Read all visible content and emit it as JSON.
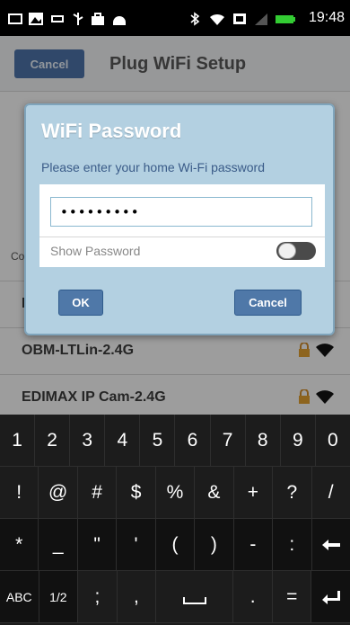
{
  "status_bar": {
    "time": "19:48",
    "icons": [
      "gallery-icon",
      "photo-icon",
      "usb-icon",
      "usb-debug-icon",
      "bag-icon",
      "android-icon",
      "bluetooth-icon",
      "wifi-icon",
      "nfc-icon",
      "signal-icon",
      "battery-icon"
    ]
  },
  "app": {
    "cancel_label": "Cancel",
    "title": "Plug WiFi Setup",
    "list_label_partial": "Co",
    "rows": [
      {
        "ssid": "E"
      },
      {
        "ssid": "OBM-LTLin-2.4G"
      },
      {
        "ssid": "EDIMAX IP Cam-2.4G"
      }
    ]
  },
  "dialog": {
    "title": "WiFi Password",
    "subtitle": "Please enter your home Wi-Fi password",
    "password_value": "•••••••••",
    "show_password_label": "Show Password",
    "show_password_on": false,
    "ok_label": "OK",
    "cancel_label": "Cancel"
  },
  "keyboard": {
    "row1": [
      "1",
      "2",
      "3",
      "4",
      "5",
      "6",
      "7",
      "8",
      "9",
      "0"
    ],
    "row2": [
      "!",
      "@",
      "#",
      "$",
      "%",
      "&",
      "+",
      "?",
      "/"
    ],
    "row3": [
      "*",
      "_",
      "\"",
      "'",
      "(",
      ")",
      "-",
      ":"
    ],
    "row4": [
      "ABC",
      "1/2",
      ";",
      ",",
      ".",
      "="
    ],
    "backspace_icon": "backspace-icon",
    "enter_icon": "enter-icon",
    "space_icon": "space-icon"
  },
  "colors": {
    "dialog_bg": "#b3d0e1",
    "button_blue": "#4f78a8",
    "subtitle_blue": "#3a5b88",
    "battery_green": "#33cc33"
  }
}
